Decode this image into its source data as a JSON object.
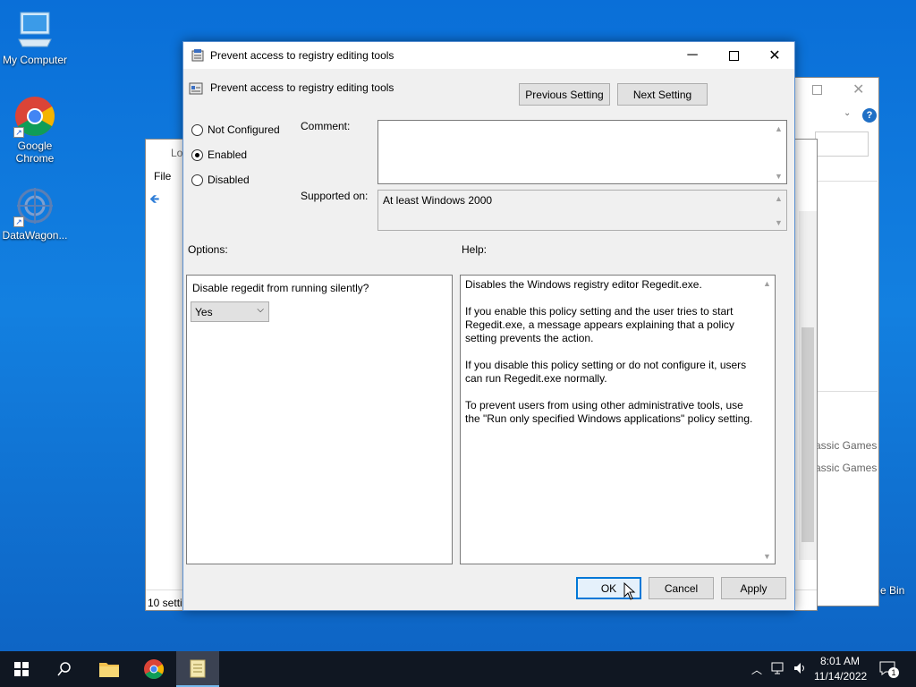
{
  "desktop": {
    "icons": [
      {
        "label": "My Computer"
      },
      {
        "label": "Google Chrome"
      },
      {
        "label": "DataWagon..."
      }
    ],
    "bg_window": {
      "title": "Lo",
      "menu_file": "File",
      "status": "10 setti",
      "games1": "assic Games",
      "games2": "assic Games",
      "bin": "e Bin"
    }
  },
  "dialog": {
    "window_title": "Prevent access to registry editing tools",
    "setting_title": "Prevent access to registry editing tools",
    "prev_button": "Previous Setting",
    "next_button": "Next Setting",
    "radios": {
      "not_configured": "Not Configured",
      "enabled": "Enabled",
      "disabled": "Disabled",
      "selected": "Enabled"
    },
    "comment_label": "Comment:",
    "comment_value": "",
    "supported_label": "Supported on:",
    "supported_value": "At least Windows 2000",
    "options_label": "Options:",
    "help_label": "Help:",
    "option_question": "Disable regedit from running silently?",
    "option_select_value": "Yes",
    "help_text": "Disables the Windows registry editor Regedit.exe.\n\nIf you enable this policy setting and the user tries to start Regedit.exe, a message appears explaining that a policy setting prevents the action.\n\nIf you disable this policy setting or do not configure it, users can run Regedit.exe normally.\n\nTo prevent users from using other administrative tools, use the \"Run only specified Windows applications\" policy setting.",
    "ok_button": "OK",
    "cancel_button": "Cancel",
    "apply_button": "Apply"
  },
  "taskbar": {
    "time": "8:01 AM",
    "date": "11/14/2022",
    "notification_count": "1"
  },
  "colors": {
    "accent": "#0078d7",
    "taskbar": "#101722"
  }
}
